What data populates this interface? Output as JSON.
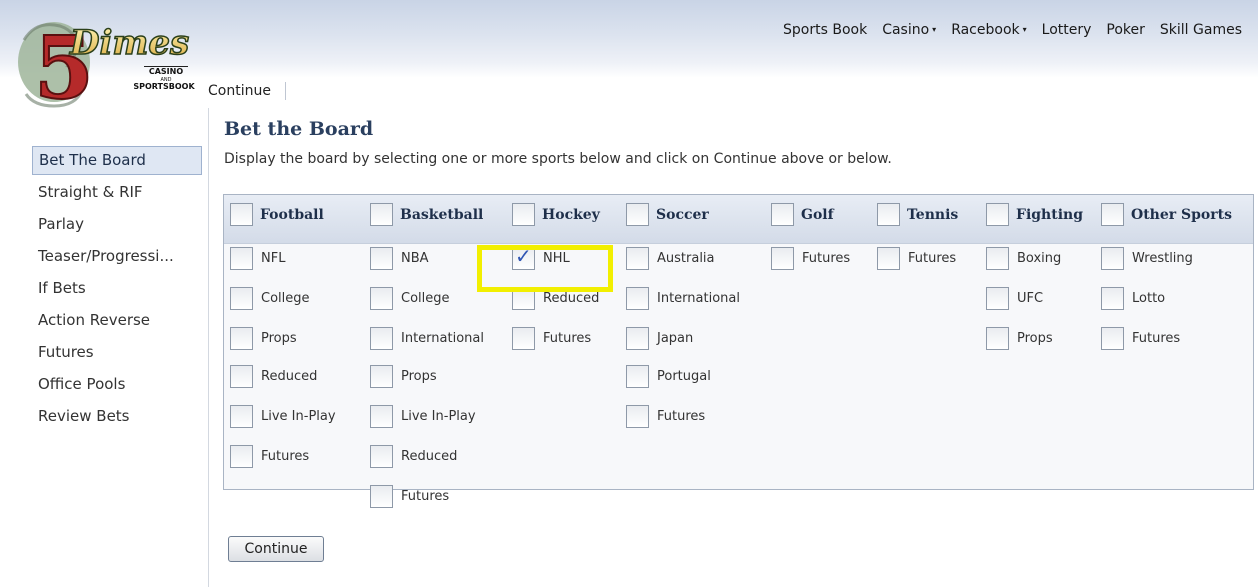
{
  "brand": {
    "logo_number": "5",
    "logo_word": "Dimes",
    "logo_line1": "CASINO",
    "logo_line2": "AND",
    "logo_line3": "SPORTSBOOK"
  },
  "topnav": [
    {
      "label": "Sports Book",
      "caret": ""
    },
    {
      "label": "Casino",
      "caret": "▾"
    },
    {
      "label": "Racebook",
      "caret": "▾"
    },
    {
      "label": "Lottery",
      "caret": ""
    },
    {
      "label": "Poker",
      "caret": ""
    },
    {
      "label": "Skill Games",
      "caret": ""
    }
  ],
  "subnav": {
    "continue_label": "Continue"
  },
  "sidebar": {
    "items": [
      {
        "label": "Bet The Board",
        "active": true
      },
      {
        "label": "Straight & RIF"
      },
      {
        "label": "Parlay"
      },
      {
        "label": "Teaser/Progressi..."
      },
      {
        "label": "If Bets"
      },
      {
        "label": "Action Reverse"
      },
      {
        "label": "Futures"
      },
      {
        "label": "Office Pools"
      },
      {
        "label": "Review Bets"
      }
    ]
  },
  "main": {
    "title": "Bet the Board",
    "description": "Display the board by selecting one or more sports below and click on Continue above or below.",
    "continue_button": "Continue"
  },
  "sports": [
    {
      "name": "Football",
      "items": [
        "NFL",
        "College",
        "Props",
        "Reduced",
        "Live In-Play",
        "Futures"
      ]
    },
    {
      "name": "Basketball",
      "items": [
        "NBA",
        "College",
        "International",
        "Props",
        "Live In-Play",
        "Reduced",
        "Futures"
      ]
    },
    {
      "name": "Hockey",
      "items": [
        "NHL",
        "Reduced",
        "Futures"
      ],
      "checked": [
        "NHL"
      ]
    },
    {
      "name": "Soccer",
      "items": [
        "Australia",
        "International",
        "Japan",
        "Portugal",
        "Futures"
      ]
    },
    {
      "name": "Golf",
      "items": [
        "Futures"
      ]
    },
    {
      "name": "Tennis",
      "items": [
        "Futures"
      ]
    },
    {
      "name": "Fighting",
      "items": [
        "Boxing",
        "UFC",
        "Props"
      ]
    },
    {
      "name": "Other Sports",
      "items": [
        "Wrestling",
        "Lotto",
        "Futures"
      ]
    }
  ],
  "colors": {
    "highlight": "#f2ef00",
    "check": "#2f55b3",
    "title": "#2a3f5f"
  }
}
